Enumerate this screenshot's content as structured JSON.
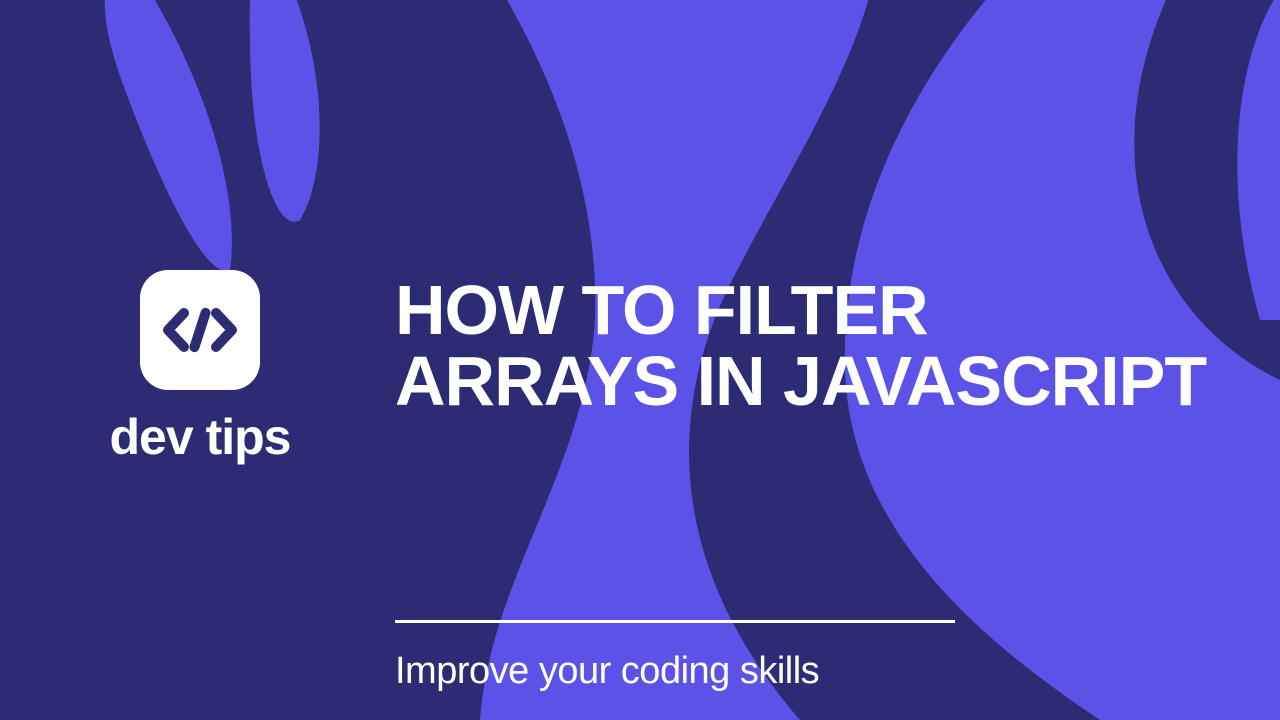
{
  "logo": {
    "brand": "dev tips",
    "icon": "code-icon"
  },
  "title": "HOW TO FILTER ARRAYS IN JAVASCRIPT",
  "subtitle": "Improve your coding skills",
  "colors": {
    "background": "#2E2B75",
    "accent": "#5B52E8",
    "text": "#FFFFFF"
  }
}
